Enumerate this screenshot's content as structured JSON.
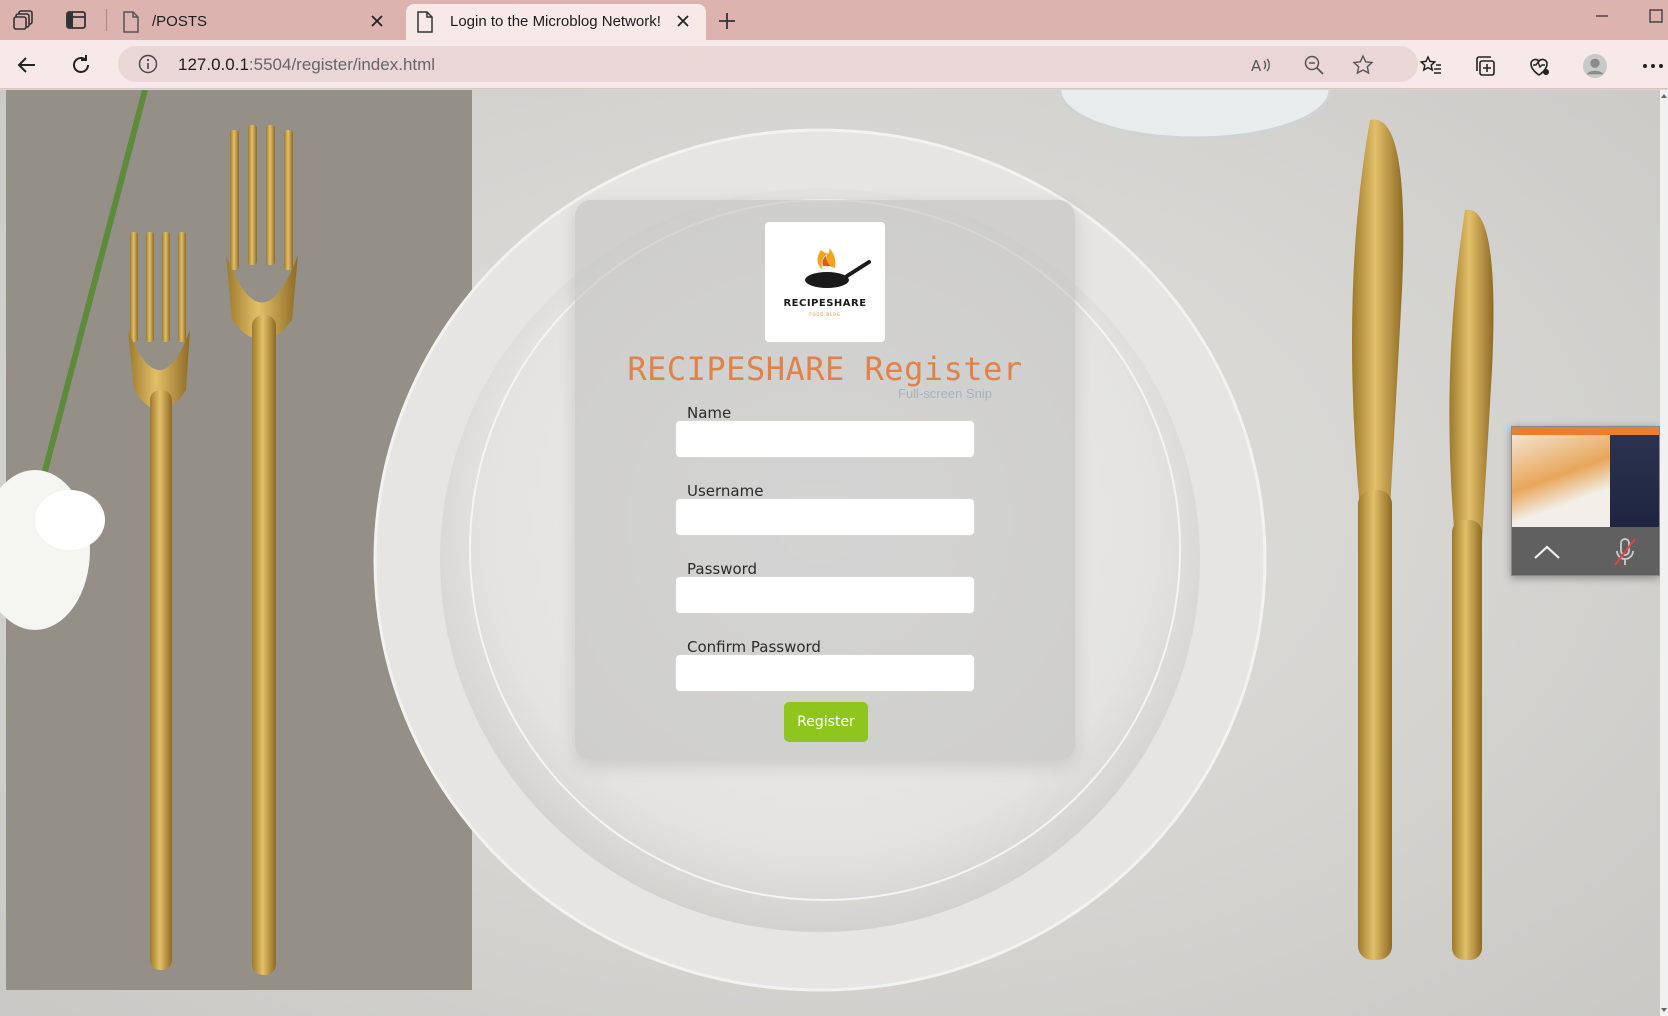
{
  "browser": {
    "tabs": [
      {
        "title": "/POSTS",
        "active": false
      },
      {
        "title": "Login to the Microblog Network!",
        "active": true
      }
    ],
    "url_host": "127.0.0.1",
    "url_rest": ":5504/register/index.html",
    "accent": "#ddb3b0"
  },
  "page": {
    "logo": {
      "brand": "RECIPESHARE",
      "tagline": "FOOD BLOG"
    },
    "title": "RECIPESHARE Register",
    "title_color": "#e0824a",
    "overlay_text": "Full-screen Snip",
    "fields": [
      {
        "label": "Name",
        "value": ""
      },
      {
        "label": "Username",
        "value": ""
      },
      {
        "label": "Password",
        "value": ""
      },
      {
        "label": "Confirm Password",
        "value": ""
      }
    ],
    "submit_label": "Register",
    "submit_color": "#8fc61d"
  },
  "icons": [
    "workspaces-icon",
    "tab-actions-icon",
    "page-icon",
    "close-icon",
    "new-tab-icon",
    "back-icon",
    "refresh-icon",
    "info-icon",
    "read-aloud-icon",
    "zoom-out-icon",
    "favorite-star-icon",
    "favorites-icon",
    "collections-icon",
    "browser-essentials-icon",
    "profile-icon",
    "more-icon",
    "minimize-icon",
    "maximize-icon",
    "chevron-up-icon",
    "mic-off-icon"
  ]
}
